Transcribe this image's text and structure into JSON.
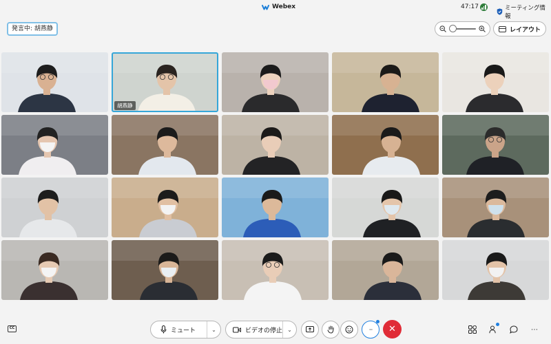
{
  "app": {
    "name": "Webex",
    "clock": "47:17",
    "meeting_info_label": "ミーティング情報"
  },
  "speaking": {
    "label": "発言中: 胡燕静"
  },
  "toolbar_top": {
    "layout_label": "レイアウト",
    "zoom_level": 0.0
  },
  "grid": {
    "active_tile_index": 1,
    "tiles": [
      {
        "name": "",
        "bg": "#dfe3e8",
        "shirt": "#2c3544",
        "skin": "#d9b192",
        "hair": "#1e1e1e",
        "mask": false,
        "glasses": true
      },
      {
        "name": "胡燕静",
        "bg": "#cfd4cf",
        "shirt": "#f3efe6",
        "skin": "#e4c4a9",
        "hair": "#2a2420",
        "mask": false,
        "glasses": true
      },
      {
        "name": "",
        "bg": "#b9b2ac",
        "shirt": "#2a2a2c",
        "skin": "#ecd2be",
        "hair": "#1b1b1b",
        "mask": true,
        "mask_color": "#f2c9cf",
        "glasses": false
      },
      {
        "name": "",
        "bg": "#c6b79a",
        "shirt": "#1e2230",
        "skin": "#d7b292",
        "hair": "#1c1a18",
        "mask": false,
        "glasses": false
      },
      {
        "name": "",
        "bg": "#e9e6e1",
        "shirt": "#2b2b2e",
        "skin": "#ecd1bb",
        "hair": "#191919",
        "mask": false,
        "glasses": false
      },
      {
        "name": "",
        "bg": "#7c7f86",
        "shirt": "#f0eef0",
        "skin": "#e5c6b0",
        "hair": "#222222",
        "mask": true,
        "mask_color": "#f4f4f4",
        "glasses": false
      },
      {
        "name": "",
        "bg": "#8a7562",
        "shirt": "#e3e8ee",
        "skin": "#ddb99c",
        "hair": "#1b1b1b",
        "mask": false,
        "glasses": false
      },
      {
        "name": "",
        "bg": "#bdb3a5",
        "shirt": "#232325",
        "skin": "#e9cdb8",
        "hair": "#1c1a19",
        "mask": false,
        "glasses": false
      },
      {
        "name": "",
        "bg": "#8f6f4e",
        "shirt": "#e7ebef",
        "skin": "#d7b293",
        "hair": "#1a1a1a",
        "mask": false,
        "glasses": false
      },
      {
        "name": "",
        "bg": "#5d6a5e",
        "shirt": "#1f2126",
        "skin": "#caa489",
        "hair": "#2b2b2b",
        "mask": false,
        "glasses": true
      },
      {
        "name": "",
        "bg": "#cfd1d3",
        "shirt": "#e6e8ea",
        "skin": "#e2c2a6",
        "hair": "#1d1d1d",
        "mask": false,
        "glasses": false
      },
      {
        "name": "",
        "bg": "#c9ad8c",
        "shirt": "#c9ccd2",
        "skin": "#e1c0a3",
        "hair": "#1d1c1b",
        "mask": true,
        "mask_color": "#f3f3f3",
        "glasses": false
      },
      {
        "name": "",
        "bg": "#7fb2d9",
        "shirt": "#2c5db8",
        "skin": "#dcb99a",
        "hair": "#1a1a1a",
        "mask": false,
        "glasses": false
      },
      {
        "name": "",
        "bg": "#d6d8d6",
        "shirt": "#1f2124",
        "skin": "#e4c5aa",
        "hair": "#181818",
        "mask": true,
        "mask_color": "#dfe9ef",
        "glasses": false
      },
      {
        "name": "",
        "bg": "#a8917a",
        "shirt": "#2a2d30",
        "skin": "#dbb99c",
        "hair": "#1d1d1d",
        "mask": true,
        "mask_color": "#cfe1ec",
        "glasses": false
      },
      {
        "name": "",
        "bg": "#b9b7b3",
        "shirt": "#3a3030",
        "skin": "#e6cab3",
        "hair": "#3a2a22",
        "mask": true,
        "mask_color": "#f4f4f4",
        "glasses": false
      },
      {
        "name": "",
        "bg": "#6e5e4f",
        "shirt": "#2a2d33",
        "skin": "#d8b597",
        "hair": "#1c1b1a",
        "mask": true,
        "mask_color": "#e9eef2",
        "glasses": false
      },
      {
        "name": "",
        "bg": "#c8bfb4",
        "shirt": "#f4f4f4",
        "skin": "#e9cdb7",
        "hair": "#1b1b1b",
        "mask": false,
        "glasses": true
      },
      {
        "name": "",
        "bg": "#b2a797",
        "shirt": "#2b2f3a",
        "skin": "#dab69a",
        "hair": "#1a1a1a",
        "mask": false,
        "glasses": false
      },
      {
        "name": "",
        "bg": "#d7d8d9",
        "shirt": "#3d3a36",
        "skin": "#e3c3a8",
        "hair": "#1a1a1a",
        "mask": true,
        "mask_color": "#f2f2f2",
        "glasses": false
      }
    ]
  },
  "controls": {
    "mute_label": "ミュート",
    "video_label": "ビデオの停止",
    "cc_label": "CC",
    "more_label": "···"
  },
  "colors": {
    "end_call": "#e02c37",
    "active_border": "#35a6d8",
    "speaking_border": "#80bfe6"
  }
}
